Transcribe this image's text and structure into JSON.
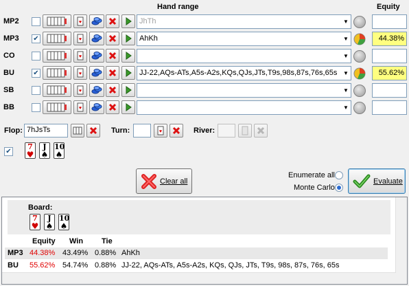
{
  "header": {
    "hand_range": "Hand range",
    "equity": "Equity"
  },
  "players": [
    {
      "pos": "MP2",
      "checked": false,
      "range": "JhTh",
      "range_placeholder": true,
      "equity": "",
      "status": "grey"
    },
    {
      "pos": "MP3",
      "checked": true,
      "range": "AhKh",
      "range_placeholder": false,
      "equity": "44.38%",
      "status": "pie"
    },
    {
      "pos": "CO",
      "checked": false,
      "range": "",
      "range_placeholder": false,
      "equity": "",
      "status": "grey"
    },
    {
      "pos": "BU",
      "checked": true,
      "range": "JJ-22,AQs-ATs,A5s-A2s,KQs,QJs,JTs,T9s,98s,87s,76s,65s",
      "range_placeholder": false,
      "equity": "55.62%",
      "status": "pie"
    },
    {
      "pos": "SB",
      "checked": false,
      "range": "",
      "range_placeholder": false,
      "equity": "",
      "status": "grey"
    },
    {
      "pos": "BB",
      "checked": false,
      "range": "",
      "range_placeholder": false,
      "equity": "",
      "status": "grey"
    }
  ],
  "board": {
    "flop_label": "Flop:",
    "flop_value": "7hJsTs",
    "turn_label": "Turn:",
    "turn_value": "",
    "river_label": "River:",
    "river_value": "",
    "cards": [
      {
        "rank": "7",
        "suit": "♥",
        "color": "red"
      },
      {
        "rank": "J",
        "suit": "♠",
        "color": "black"
      },
      {
        "rank": "10",
        "suit": "♠",
        "color": "black"
      }
    ]
  },
  "actions": {
    "clear_all": "Clear all",
    "enumerate_all": "Enumerate all",
    "monte_carlo": "Monte Carlo",
    "evaluate": "Evaluate",
    "mode": "monte_carlo"
  },
  "results": {
    "board_label": "Board:",
    "headers": {
      "equity": "Equity",
      "win": "Win",
      "tie": "Tie"
    },
    "rows": [
      {
        "pos": "MP3",
        "equity": "44.38%",
        "win": "43.49%",
        "tie": "0.88%",
        "hand": "AhKh"
      },
      {
        "pos": "BU",
        "equity": "55.62%",
        "win": "54.74%",
        "tie": "0.88%",
        "hand": "JJ-22, AQs-ATs, A5s-A2s, KQs, QJs, JTs, T9s, 98s, 87s, 76s, 65s"
      }
    ]
  },
  "colors": {
    "highlight": "#ffff80",
    "equity_red": "#e00000",
    "accent": "#3c7fb1"
  }
}
